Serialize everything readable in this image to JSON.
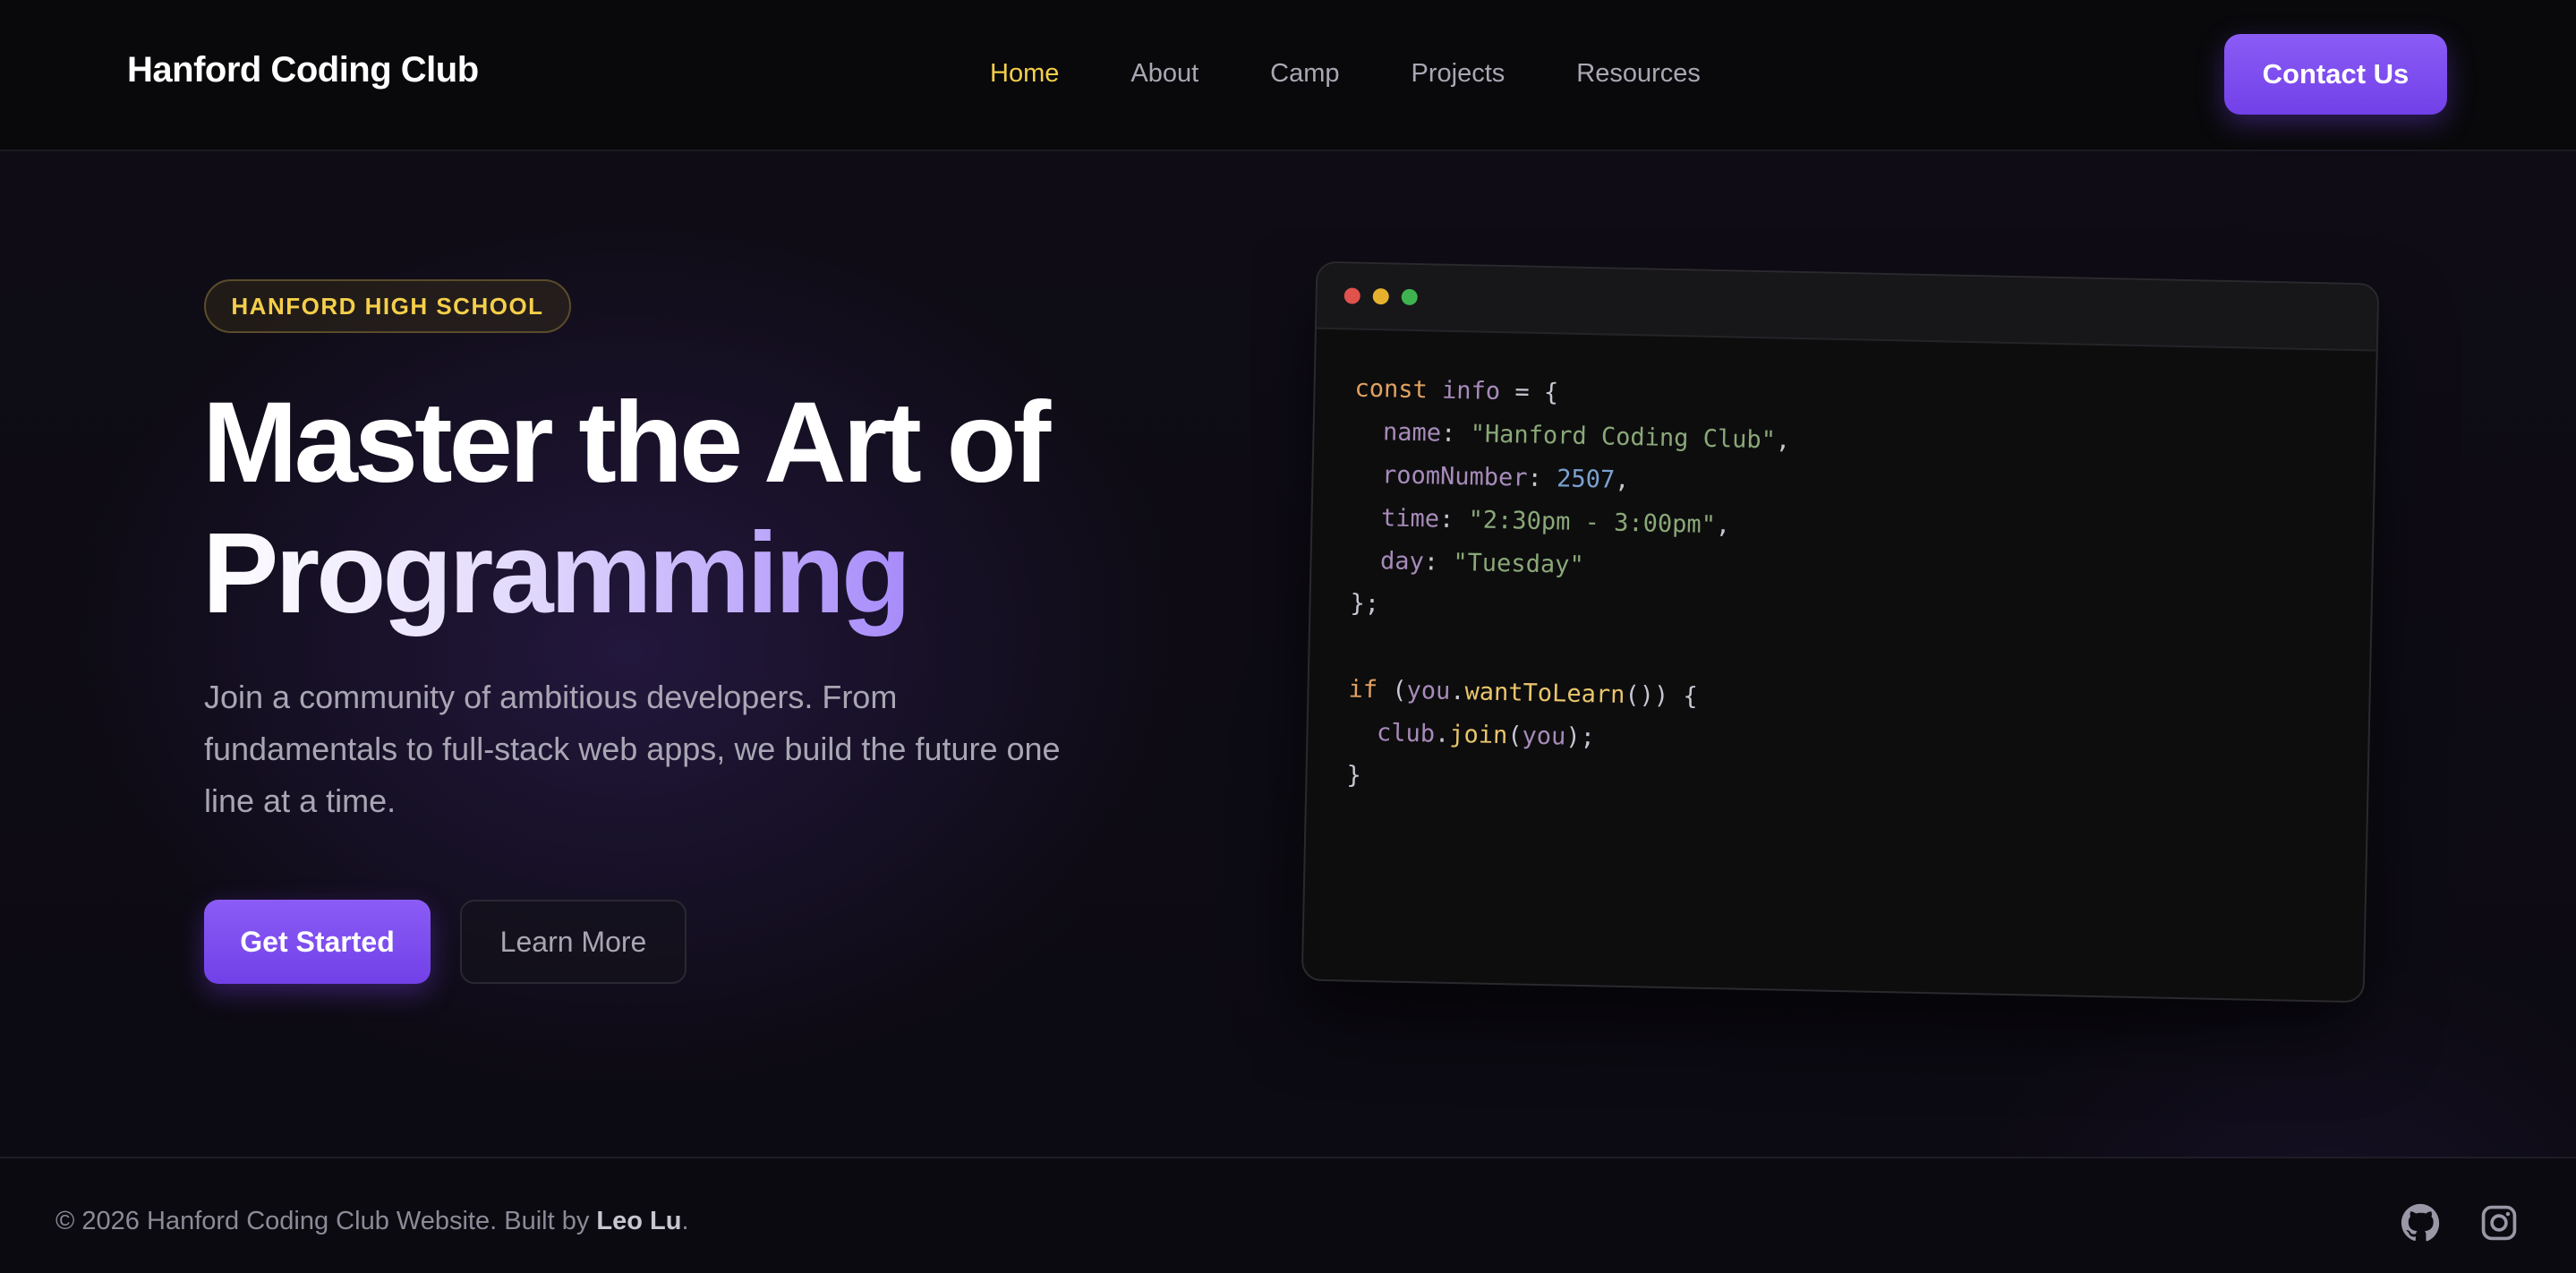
{
  "nav": {
    "brand": "Hanford Coding Club",
    "links": [
      "Home",
      "About",
      "Camp",
      "Projects",
      "Resources"
    ],
    "active_link": "Home",
    "contact_label": "Contact Us"
  },
  "hero": {
    "badge": "HANFORD HIGH SCHOOL",
    "headline_line1": "Master the Art of",
    "headline_line2": "Programming",
    "subtext": "Join a community of ambitious developers. From fundamentals to full-stack web apps, we build the future one line at a time.",
    "primary_cta": "Get Started",
    "secondary_cta": "Learn More"
  },
  "code": {
    "lines": [
      "const info = {",
      "  name: \"Hanford Coding Club\",",
      "  roomNumber: 2507,",
      "  time: \"2:30pm - 3:00pm\",",
      "  day: \"Tuesday\"",
      "};",
      "",
      "if (you.wantToLearn()) {",
      "  club.join(you);",
      "}"
    ]
  },
  "footer": {
    "copyright_prefix": "© 2026 Hanford Coding Club Website. Built by",
    "author": "Leo Lu",
    "copyright_suffix": ".",
    "social_icons": [
      "github-icon",
      "instagram-icon"
    ]
  },
  "colors": {
    "accent_purple": "#8b5cf6",
    "accent_yellow": "#f5cf4a",
    "background": "#0a090d"
  }
}
